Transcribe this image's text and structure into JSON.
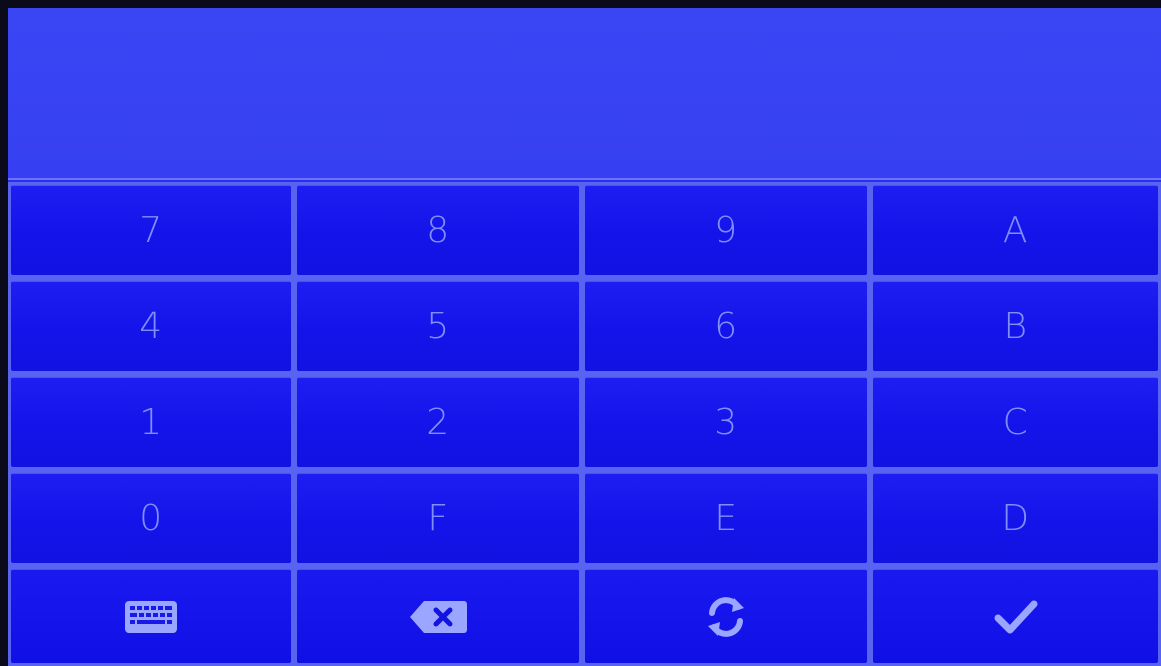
{
  "display": {
    "value": ""
  },
  "keys": {
    "row1": [
      "7",
      "8",
      "9",
      "A"
    ],
    "row2": [
      "4",
      "5",
      "6",
      "B"
    ],
    "row3": [
      "1",
      "2",
      "3",
      "C"
    ],
    "row4": [
      "0",
      "F",
      "E",
      "D"
    ]
  },
  "actions": [
    {
      "icon": "keyboard-icon"
    },
    {
      "icon": "backspace-icon"
    },
    {
      "icon": "refresh-icon"
    },
    {
      "icon": "check-icon"
    }
  ],
  "colors": {
    "background": "#2a2ef0",
    "key": "#1414ea",
    "key_text": "#8f9bff",
    "divider": "#5a62f0"
  }
}
